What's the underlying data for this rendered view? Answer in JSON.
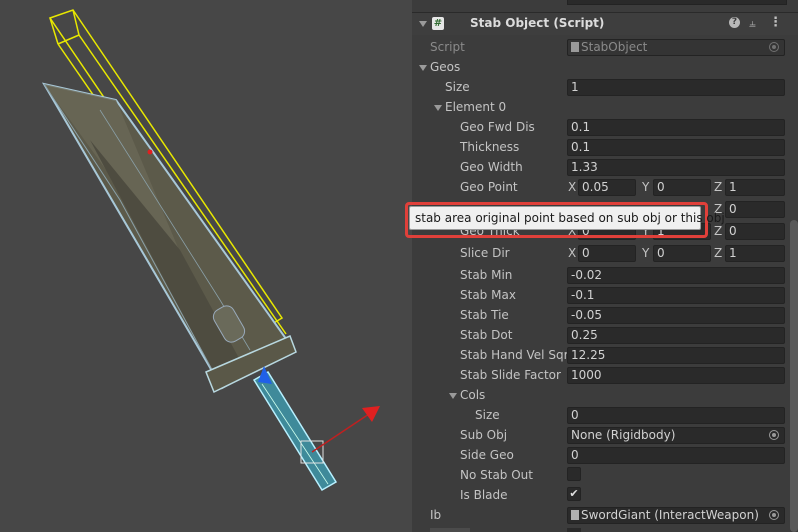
{
  "component": {
    "header_top_partial": "",
    "title": "Stab Object (Script)",
    "script_label": "Script",
    "script_value": "StabObject"
  },
  "geos": {
    "label": "Geos",
    "size_label": "Size",
    "size_value": "1",
    "element_label": "Element 0",
    "props": [
      {
        "label": "Geo Fwd Dis",
        "value": "0.1"
      },
      {
        "label": "Thickness",
        "value": "0.1"
      },
      {
        "label": "Geo Width",
        "value": "1.33"
      }
    ],
    "geo_point": {
      "label": "Geo Point",
      "x": "0.05",
      "y": "0",
      "z": "1"
    },
    "hidden_row": {
      "z": "0"
    },
    "geo_thick": {
      "label": "Geo Thick",
      "x": "0",
      "y": "1",
      "z": "0"
    },
    "slice_dir": {
      "label": "Slice Dir",
      "x": "0",
      "y": "0",
      "z": "1"
    },
    "stab_props": [
      {
        "label": "Stab Min",
        "value": "-0.02"
      },
      {
        "label": "Stab Max",
        "value": "-0.1"
      },
      {
        "label": "Stab Tie",
        "value": "-0.05"
      },
      {
        "label": "Stab Dot",
        "value": "0.25"
      },
      {
        "label": "Stab Hand Vel Sqrt",
        "value": "12.25"
      },
      {
        "label": "Stab Slide Factor",
        "value": "1000"
      }
    ],
    "cols": {
      "label": "Cols",
      "size_label": "Size",
      "size_value": "0"
    },
    "sub_obj": {
      "label": "Sub Obj",
      "value": "None (Rigidbody)"
    },
    "side_geo": {
      "label": "Side Geo",
      "value": "0"
    },
    "no_stab_out": {
      "label": "No Stab Out",
      "checked": false
    },
    "is_blade": {
      "label": "Is Blade",
      "checked": true
    }
  },
  "ib": {
    "label": "Ib",
    "value": "SwordGiant (InteractWeapon)"
  },
  "tooltip": {
    "text": "stab area original point based on sub obj or this obj",
    "highlight_color": "#e0403a"
  },
  "axes": {
    "x": "X",
    "y": "Y",
    "z": "Z"
  },
  "icons": [
    "script-hash-icon",
    "help-icon",
    "preset-sliders-icon",
    "kebab-menu-icon",
    "object-picker-icon",
    "checkmark-icon"
  ]
}
